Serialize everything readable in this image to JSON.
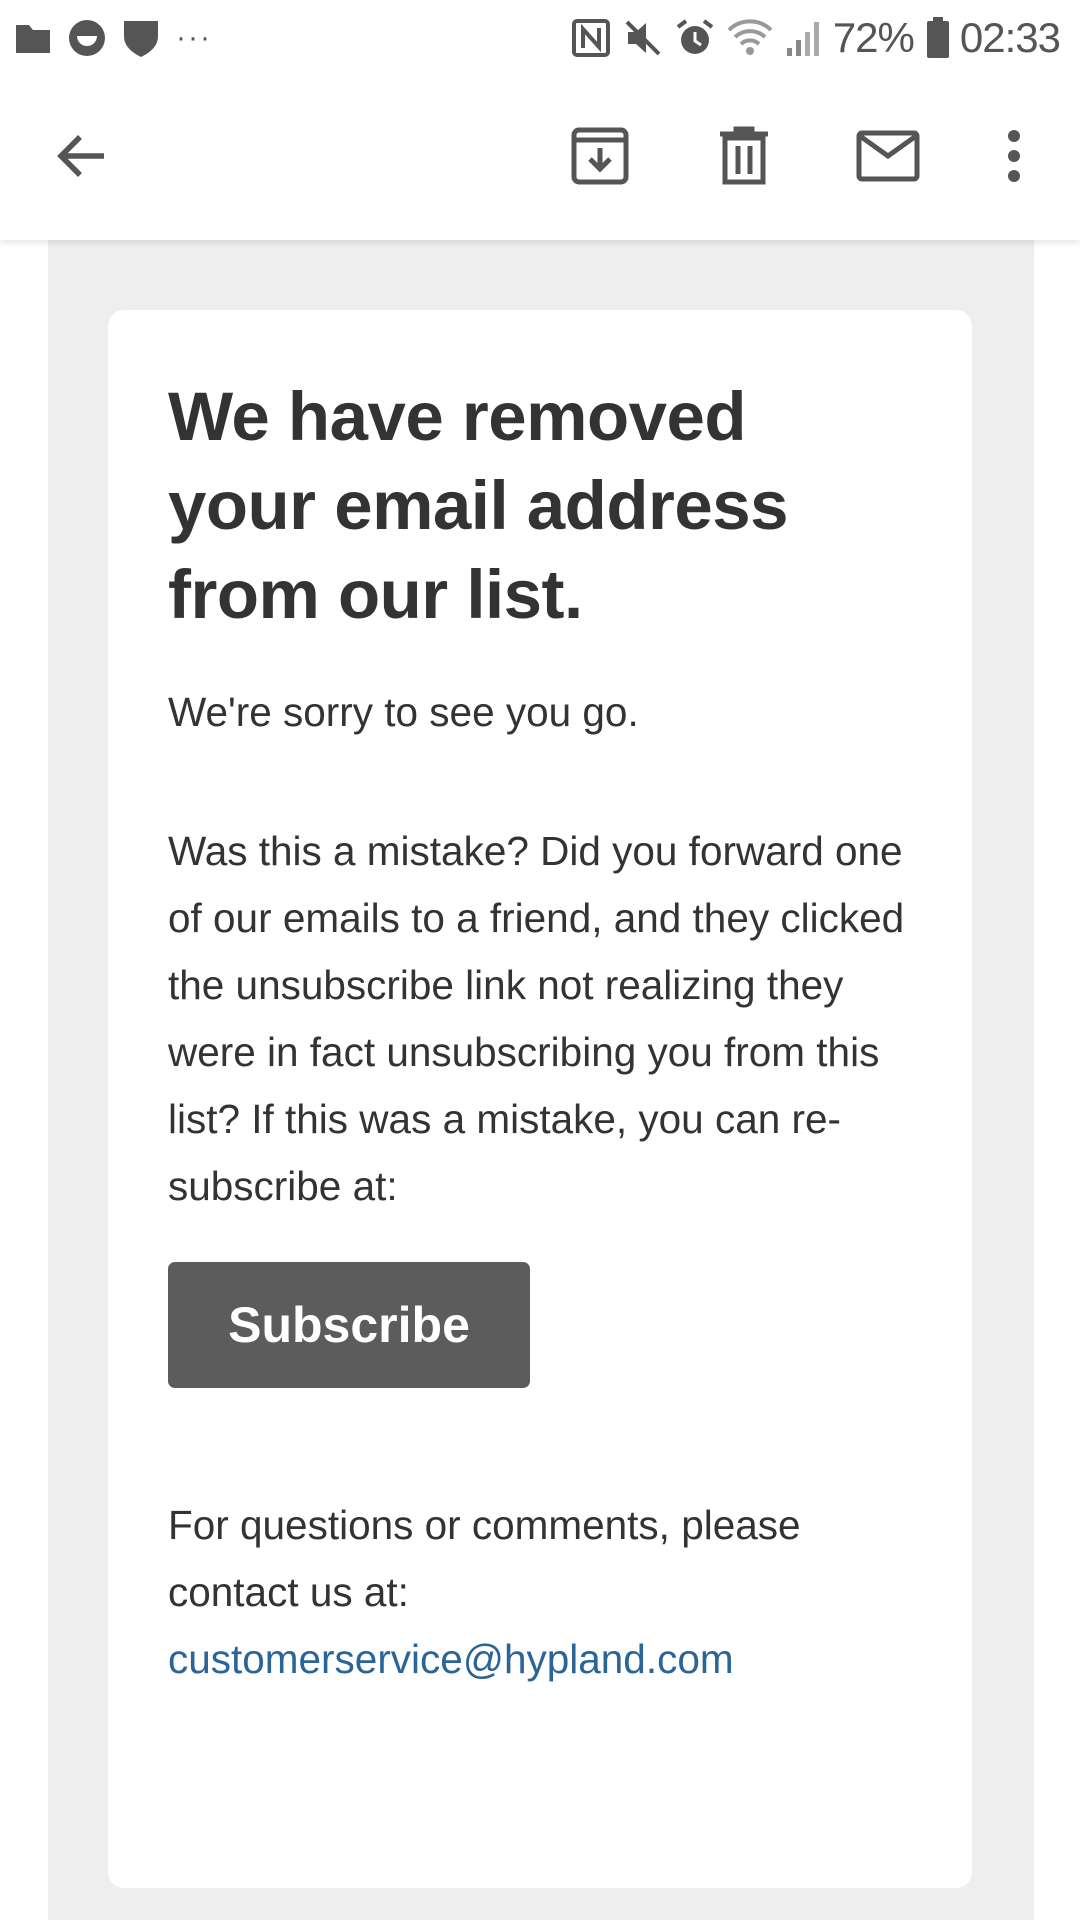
{
  "status_bar": {
    "left_icons": [
      "folder-icon",
      "face-icon",
      "shield-icon",
      "more-notifications-icon"
    ],
    "right_icons": [
      "nfc-icon",
      "mute-icon",
      "alarm-icon",
      "wifi-icon",
      "signal-icon",
      "battery-icon"
    ],
    "overflow": "···",
    "battery_percent": "72%",
    "time": "02:33"
  },
  "toolbar": {
    "back_icon": "arrow-back-icon",
    "archive_icon": "archive-icon",
    "delete_icon": "trash-icon",
    "mark_unread_icon": "mail-icon",
    "more_icon": "more-vert-icon"
  },
  "colors": {
    "background": "#ffffff",
    "email_background": "#eeeeee",
    "text": "#333333",
    "button": "#5c5c5c",
    "link": "#2b6496"
  },
  "email": {
    "headline": "We have removed your email address from our list.",
    "sorry_text": "We're sorry to see you go.",
    "mistake_text": "Was this a mistake? Did you forward one of our emails to a friend, and they clicked the unsubscribe link not realizing they were in fact unsubscribing you from this list? If this was a mistake, you can re-subscribe at:",
    "subscribe_label": "Subscribe",
    "contact_text": "For questions or comments, please contact us at:",
    "contact_email": "customerservice@hypland.com"
  }
}
